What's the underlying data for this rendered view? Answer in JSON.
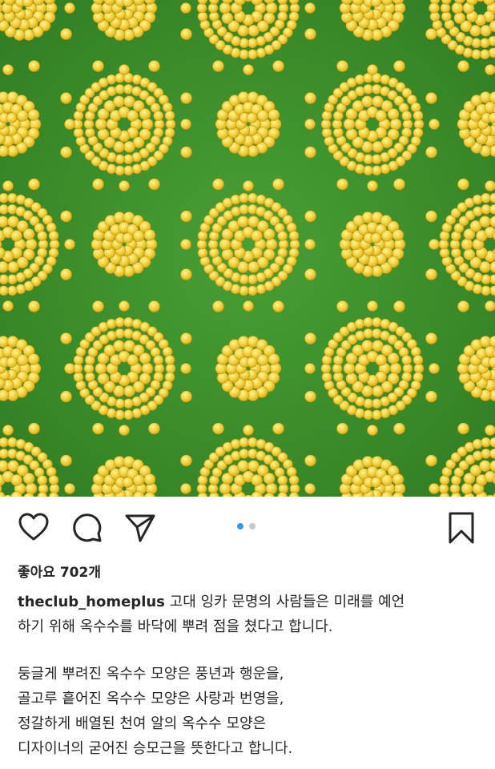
{
  "post": {
    "likes_label": "좋아요 702개",
    "username": "theclub_homeplus",
    "caption_lines": [
      "고대 잉카 문명의 사람들은 미래를 예언",
      "하기 위해 옥수수를 바닥에 뿌려 점을 쳤다고 합니다."
    ],
    "paragraph_lines": [
      "둥글게 뿌려진 옥수수 모양은 풍년과 행운을,",
      "골고루 흩어진 옥수수 모양은 사랑과 번영을,",
      "정갈하게 배열된 천여 알의 옥수수 모양은",
      "디자이너의 굳어진 승모근을 뜻한다고 합니다."
    ]
  },
  "icons": {
    "like": "heart-icon",
    "comment": "comment-icon",
    "share": "send-icon",
    "save": "bookmark-icon"
  },
  "carousel": {
    "count": 2,
    "active_index": 0,
    "active_color": "#3897f0",
    "inactive_color": "#c7c7c7"
  },
  "colors": {
    "grass": "#3f8d2b",
    "corn": "#f2d23b",
    "corn_dark": "#d8a81d"
  }
}
